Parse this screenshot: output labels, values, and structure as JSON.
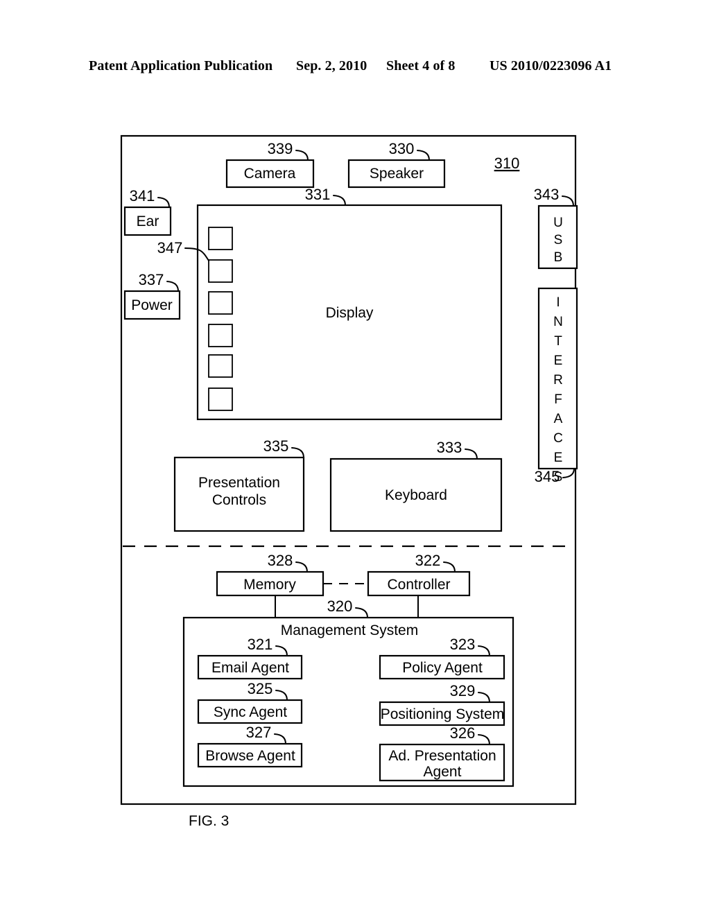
{
  "header": {
    "publication": "Patent Application Publication",
    "date": "Sep. 2, 2010",
    "sheet": "Sheet 4 of 8",
    "patent_number": "US 2010/0223096 A1"
  },
  "figure": {
    "caption": "FIG. 3",
    "device_ref": "310"
  },
  "blocks": {
    "camera": {
      "label": "Camera",
      "ref": "339"
    },
    "speaker": {
      "label": "Speaker",
      "ref": "330"
    },
    "ear": {
      "label": "Ear",
      "ref": "341"
    },
    "power": {
      "label": "Power",
      "ref": "337"
    },
    "display": {
      "label": "Display",
      "ref": "331"
    },
    "buttons": {
      "label": "",
      "ref": "347",
      "count": 6
    },
    "usb": {
      "label": "USB",
      "ref": "343"
    },
    "interfaces": {
      "label": "INTERFACES",
      "ref": "345"
    },
    "pres_controls": {
      "label_line1": "Presentation",
      "label_line2": "Controls",
      "ref": "335"
    },
    "keyboard": {
      "label": "Keyboard",
      "ref": "333"
    },
    "memory": {
      "label": "Memory",
      "ref": "328"
    },
    "controller": {
      "label": "Controller",
      "ref": "322"
    },
    "mgmt_system": {
      "label": "Management System",
      "ref": "320"
    },
    "email_agent": {
      "label": "Email Agent",
      "ref": "321"
    },
    "policy_agent": {
      "label": "Policy Agent",
      "ref": "323"
    },
    "sync_agent": {
      "label": "Sync Agent",
      "ref": "325"
    },
    "positioning_system": {
      "label": "Positioning System",
      "ref": "329"
    },
    "browse_agent": {
      "label": "Browse Agent",
      "ref": "327"
    },
    "ad_presentation_agent": {
      "label_line1": "Ad. Presentation",
      "label_line2": "Agent",
      "ref": "326"
    }
  },
  "colors": {
    "ink": "#000000",
    "paper": "#ffffff"
  }
}
